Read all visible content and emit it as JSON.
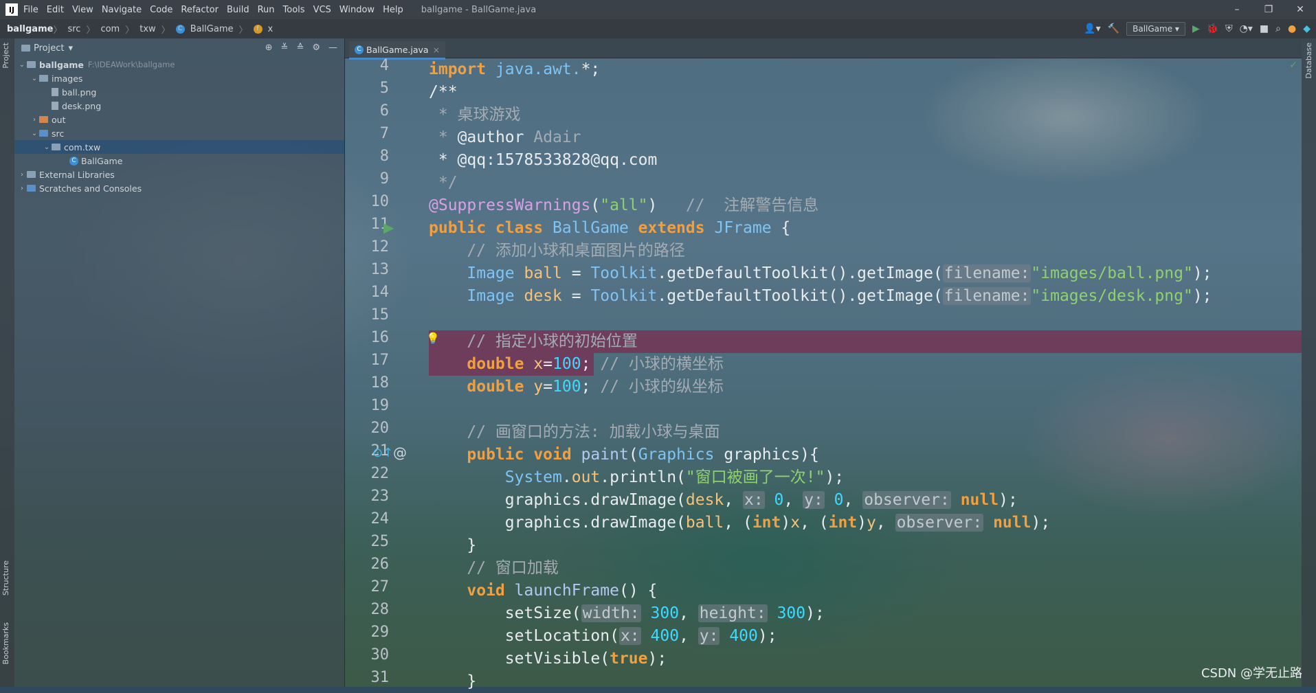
{
  "app": {
    "window_title": "ballgame - BallGame.java",
    "logo": "IJ",
    "menu": [
      "File",
      "Edit",
      "View",
      "Navigate",
      "Code",
      "Refactor",
      "Build",
      "Run",
      "Tools",
      "VCS",
      "Window",
      "Help"
    ]
  },
  "breadcrumb": [
    "ballgame",
    "src",
    "com",
    "txw",
    "BallGame",
    "x"
  ],
  "toolbar": {
    "run_config": "BallGame"
  },
  "left_strip": {
    "project": "Project",
    "structure": "Structure",
    "bookmarks": "Bookmarks"
  },
  "right_strip": {
    "database": "Database"
  },
  "project_panel": {
    "title": "Project",
    "tree": [
      {
        "label": "ballgame",
        "path": "F:\\IDEAWork\\ballgame",
        "depth": 0,
        "type": "module",
        "expanded": true
      },
      {
        "label": "images",
        "depth": 1,
        "type": "folder",
        "expanded": true
      },
      {
        "label": "ball.png",
        "depth": 2,
        "type": "file"
      },
      {
        "label": "desk.png",
        "depth": 2,
        "type": "file"
      },
      {
        "label": "out",
        "depth": 1,
        "type": "folder-orange",
        "expanded": false
      },
      {
        "label": "src",
        "depth": 1,
        "type": "folder-blue",
        "expanded": true
      },
      {
        "label": "com.txw",
        "depth": 2,
        "type": "package",
        "expanded": true,
        "selected": true
      },
      {
        "label": "BallGame",
        "depth": 3,
        "type": "class"
      },
      {
        "label": "External Libraries",
        "depth": 0,
        "type": "lib",
        "expanded": false
      },
      {
        "label": "Scratches and Consoles",
        "depth": 0,
        "type": "scratch",
        "expanded": false
      }
    ]
  },
  "editor": {
    "tab": "BallGame.java",
    "line_numbers": [
      "4",
      "5",
      "6",
      "7",
      "8",
      "9",
      "10",
      "11",
      "12",
      "13",
      "14",
      "15",
      "16",
      "17",
      "18",
      "19",
      "20",
      "21",
      "22",
      "23",
      "24",
      "25",
      "26",
      "27",
      "28",
      "29",
      "30",
      "31"
    ],
    "lines": [
      "import java.awt.*;",
      "/**",
      " * 桌球游戏",
      " * @author Adair",
      " * @qq:1578533828@qq.com",
      " */",
      "@SuppressWarnings(\"all\")   //  注解警告信息",
      "public class BallGame extends JFrame {",
      "    // 添加小球和桌面图片的路径",
      "    Image ball = Toolkit.getDefaultToolkit().getImage(filename: \"images/ball.png\");",
      "    Image desk = Toolkit.getDefaultToolkit().getImage(filename: \"images/desk.png\");",
      "",
      "    // 指定小球的初始位置",
      "    double x=100; // 小球的横坐标",
      "    double y=100; // 小球的纵坐标",
      "",
      "    // 画窗口的方法: 加载小球与桌面",
      "    public void paint(Graphics graphics){",
      "        System.out.println(\"窗口被画了一次!\");",
      "        graphics.drawImage(desk, x: 0, y: 0, observer: null);",
      "        graphics.drawImage(ball, (int)x, (int)y, observer: null);",
      "    }",
      "    // 窗口加载",
      "    void launchFrame() {",
      "        setSize(width: 300, height: 300);",
      "        setLocation(x: 400, y: 400);",
      "        setVisible(true);",
      "    }"
    ]
  },
  "watermark": "CSDN @学无止路"
}
